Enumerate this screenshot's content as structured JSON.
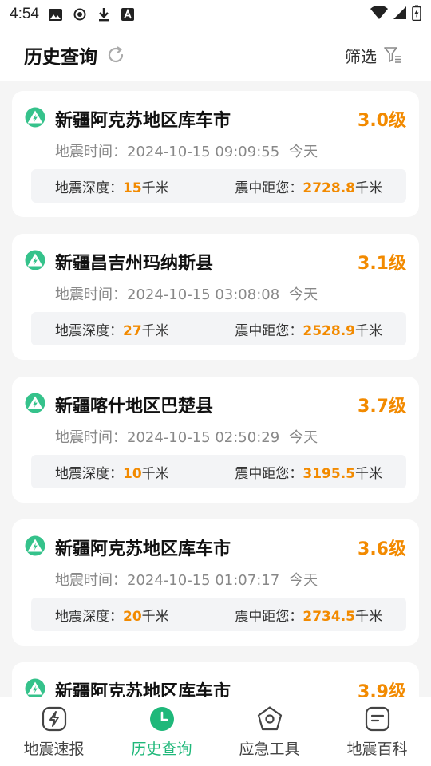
{
  "status": {
    "time": "4:54"
  },
  "header": {
    "title": "历史查询",
    "filter_label": "筛选"
  },
  "labels": {
    "time_prefix": "地震时间：",
    "depth_prefix": "地震深度：",
    "dist_prefix": "震中距您：",
    "unit_km": "千米"
  },
  "quakes": [
    {
      "place": "新疆阿克苏地区库车市",
      "magnitude": "3.0级",
      "time": "2024-10-15 09:09:55",
      "day": "今天",
      "depth": "15",
      "distance": "2728.8"
    },
    {
      "place": "新疆昌吉州玛纳斯县",
      "magnitude": "3.1级",
      "time": "2024-10-15 03:08:08",
      "day": "今天",
      "depth": "27",
      "distance": "2528.9"
    },
    {
      "place": "新疆喀什地区巴楚县",
      "magnitude": "3.7级",
      "time": "2024-10-15 02:50:29",
      "day": "今天",
      "depth": "10",
      "distance": "3195.5"
    },
    {
      "place": "新疆阿克苏地区库车市",
      "magnitude": "3.6级",
      "time": "2024-10-15 01:07:17",
      "day": "今天",
      "depth": "20",
      "distance": "2734.5"
    },
    {
      "place": "新疆阿克苏地区库车市",
      "magnitude": "3.9级"
    }
  ],
  "tabs": [
    {
      "label": "地震速报"
    },
    {
      "label": "历史查询"
    },
    {
      "label": "应急工具"
    },
    {
      "label": "地震百科"
    }
  ],
  "colors": {
    "accent": "#1fb87a",
    "magnitude": "#f28a00"
  }
}
